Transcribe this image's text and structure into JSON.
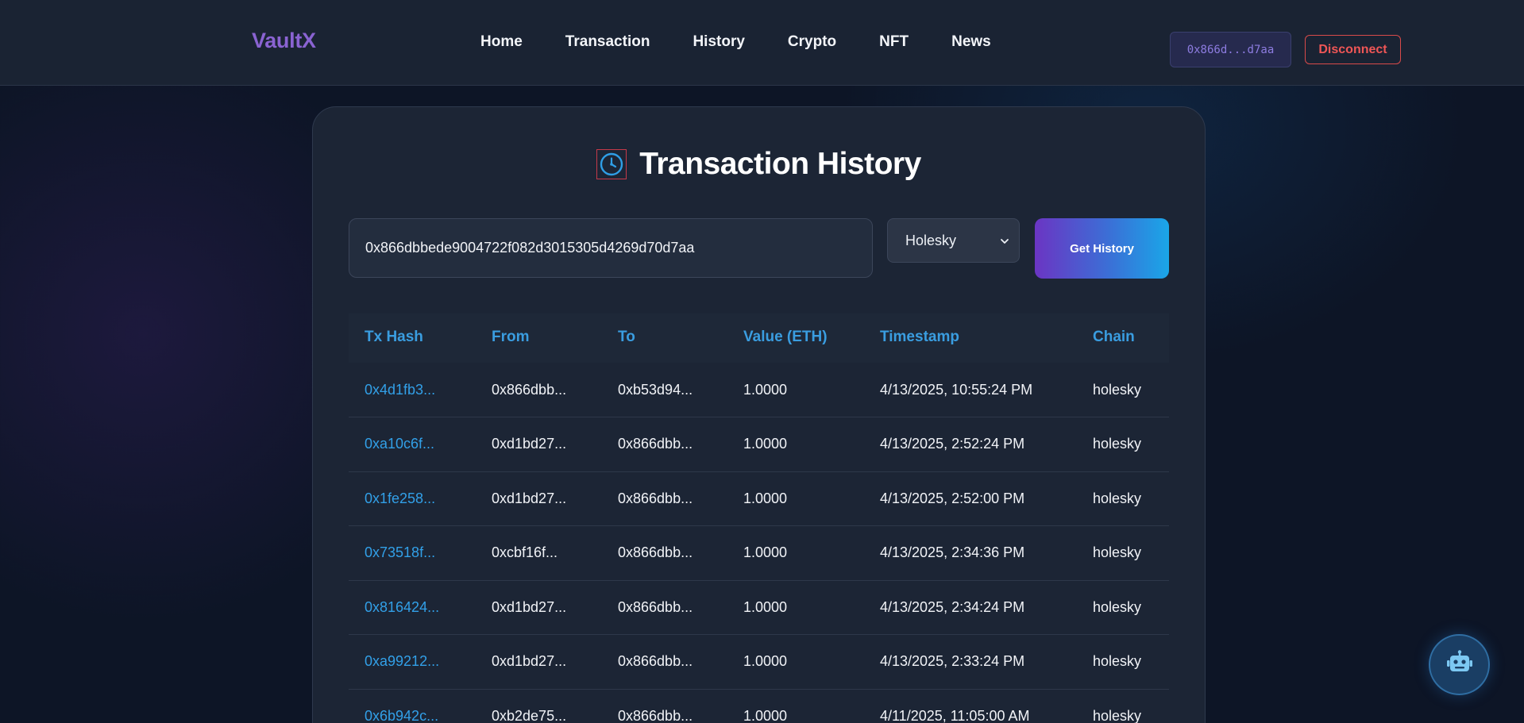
{
  "header": {
    "logo": "VaultX",
    "nav": [
      "Home",
      "Transaction",
      "History",
      "Crypto",
      "NFT",
      "News"
    ],
    "wallet_short": "0x866d...d7aa",
    "disconnect_label": "Disconnect"
  },
  "main": {
    "title": "Transaction History",
    "title_icon": "clock-icon",
    "address_value": "0x866dbbede9004722f082d3015305d4269d70d7aa",
    "chain_selected": "Holesky",
    "get_history_label": "Get History"
  },
  "table": {
    "columns": [
      "Tx Hash",
      "From",
      "To",
      "Value (ETH)",
      "Timestamp",
      "Chain"
    ],
    "rows": [
      [
        "0x4d1fb3...",
        "0x866dbb...",
        "0xb53d94...",
        "1.0000",
        "4/13/2025, 10:55:24 PM",
        "holesky"
      ],
      [
        "0xa10c6f...",
        "0xd1bd27...",
        "0x866dbb...",
        "1.0000",
        "4/13/2025, 2:52:24 PM",
        "holesky"
      ],
      [
        "0x1fe258...",
        "0xd1bd27...",
        "0x866dbb...",
        "1.0000",
        "4/13/2025, 2:52:00 PM",
        "holesky"
      ],
      [
        "0x73518f...",
        "0xcbf16f...",
        "0x866dbb...",
        "1.0000",
        "4/13/2025, 2:34:36 PM",
        "holesky"
      ],
      [
        "0x816424...",
        "0xd1bd27...",
        "0x866dbb...",
        "1.0000",
        "4/13/2025, 2:34:24 PM",
        "holesky"
      ],
      [
        "0xa99212...",
        "0xd1bd27...",
        "0x866dbb...",
        "1.0000",
        "4/13/2025, 2:33:24 PM",
        "holesky"
      ],
      [
        "0x6b942c...",
        "0xb2de75...",
        "0x866dbb...",
        "1.0000",
        "4/11/2025, 11:05:00 AM",
        "holesky"
      ]
    ]
  },
  "assistant": {
    "icon": "robot-icon"
  },
  "colors": {
    "accent_purple": "#8a63d2",
    "accent_blue": "#32a0e8",
    "danger": "#ef5656",
    "background": "#0d1526",
    "card": "#1c2535"
  }
}
